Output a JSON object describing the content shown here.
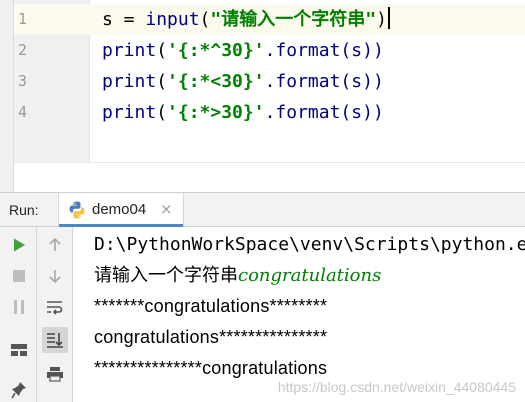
{
  "editor": {
    "line_numbers": [
      "1",
      "2",
      "3",
      "4"
    ],
    "lines": [
      {
        "var": "s",
        "op": " = ",
        "fn": "input",
        "open": "(",
        "str": "\"请输入一个字符串\"",
        "close": ")"
      },
      {
        "fn": "print",
        "open": "(",
        "str": "'{:*^30}'",
        "method": ".format(s))"
      },
      {
        "fn": "print",
        "open": "(",
        "str": "'{:*<30}'",
        "method": ".format(s))"
      },
      {
        "fn": "print",
        "open": "(",
        "str": "'{:*>30}'",
        "method": ".format(s))"
      }
    ]
  },
  "run_panel": {
    "label": "Run:",
    "tab": {
      "name": "demo04",
      "close_symbol": "×"
    }
  },
  "toolbar": {
    "left": [
      "run-icon",
      "stop-icon",
      "pause-icon",
      "layout-icon",
      "pin-icon"
    ],
    "right": [
      "up-arrow-icon",
      "down-arrow-icon",
      "soft-wrap-icon",
      "scroll-to-end-icon",
      "print-icon"
    ]
  },
  "console": {
    "path_line": "D:\\PythonWorkSpace\\venv\\Scripts\\python.exe",
    "prompt_text": "请输入一个字符串",
    "user_input": "congratulations",
    "output_center": "*******congratulations********",
    "output_left": "congratulations***************",
    "output_right": "***************congratulations"
  },
  "watermark": "https://blog.csdn.net/weixin_44080445",
  "colors": {
    "builtin": "#000080",
    "string": "#008000",
    "run_green": "#3ea03e",
    "tab_underline": "#4a88c7"
  }
}
